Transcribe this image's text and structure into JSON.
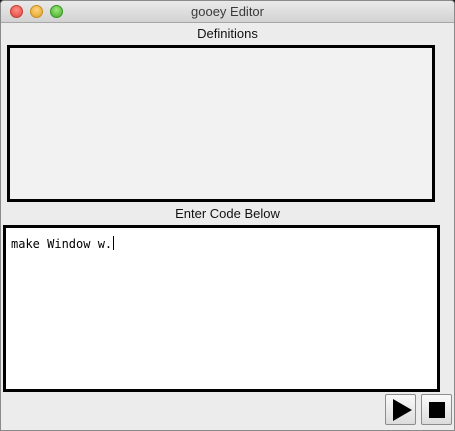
{
  "window": {
    "title": "gooey Editor"
  },
  "definitions": {
    "label": "Definitions"
  },
  "editor": {
    "label": "Enter Code Below",
    "code": "make Window w."
  },
  "controls": {
    "run_icon": "play-icon",
    "stop_icon": "stop-icon"
  },
  "colors": {
    "panel_border": "#000000",
    "definitions_bg": "#f2f2f2",
    "editor_bg": "#ffffff",
    "window_bg": "#ececec"
  }
}
